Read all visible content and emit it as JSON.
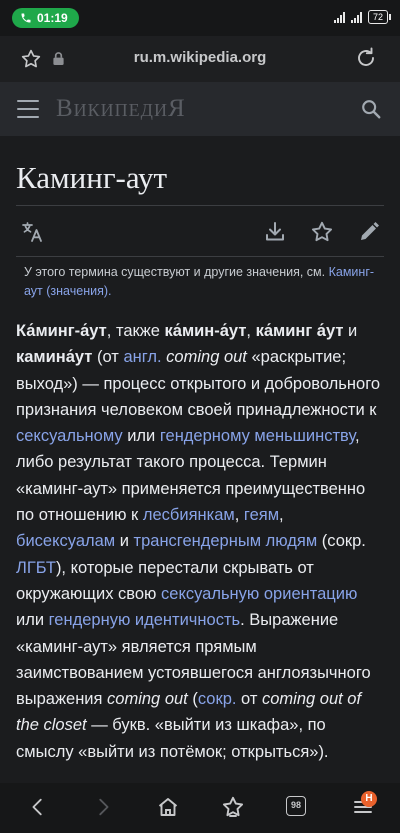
{
  "status_bar": {
    "call_time": "01:19",
    "battery": "72"
  },
  "browser": {
    "url": "ru.m.wikipedia.org"
  },
  "header": {
    "wordmark": "ВикипедиЯ"
  },
  "article": {
    "title": "Каминг-аут",
    "hatnote_text": "У этого термина существуют и другие значения, см.",
    "hatnote_link": "Каминг-аут (значения).",
    "p": {
      "b1": "Ка́минг-а́ут",
      "t1": ", также ",
      "b2": "ка́мин-а́ут",
      "t2": ", ",
      "b3": "ка́минг а́ут",
      "t3": " и ",
      "b4": "камина́ут",
      "t4": " (от ",
      "l_angl": "англ.",
      "i1": " coming out",
      "t5": " «раскрытие; выход») — процесс открытого и добровольного признания человеком своей принадлежности к ",
      "l1": "сексуальному",
      "t6": " или ",
      "l2": "гендерному меньшинству",
      "t7": ", либо результат такого процесса. Термин «каминг-аут» применяется преимущественно по отношению к ",
      "l3": "лесбиянкам",
      "t8": ", ",
      "l4": "геям",
      "t9": ", ",
      "l5": "бисексуалам",
      "t10": " и ",
      "l6": "трансгендерным людям",
      "t11": " (сокр. ",
      "l7": "ЛГБТ",
      "t12": "), которые перестали скрывать от окружающих свою ",
      "l8": "сексуальную ориентацию",
      "t13": " или ",
      "l9": "гендерную идентичность",
      "t14": ". Выражение «каминг-аут» является прямым заимствованием устоявшегося англоязычного выражения ",
      "i2": "coming out",
      "t15": " (",
      "l10": "сокр.",
      "t16": " от ",
      "i3": "coming out of the closet",
      "t17": " — букв. «выйти из шкафа», по смыслу «выйти из потёмок; открыться»)."
    }
  },
  "bottom_nav": {
    "tabs_count": "98",
    "menu_badge": "H"
  },
  "colors": {
    "link": "#88a3e8",
    "background": "#1b1c1e",
    "call_pill": "#1fa84a",
    "badge": "#e8612c"
  }
}
